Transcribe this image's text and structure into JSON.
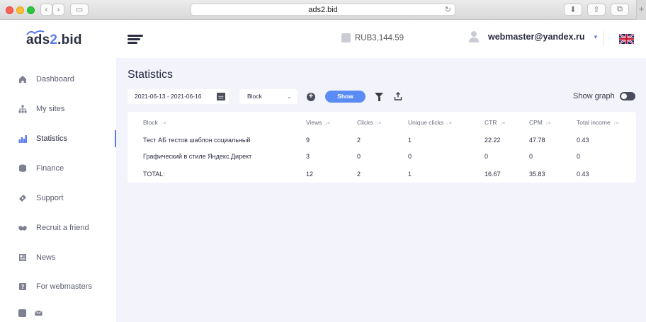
{
  "browser": {
    "url": "ads2.bid"
  },
  "header": {
    "logo_prefix": "ads",
    "logo_two": "2",
    "logo_suffix": ".bid",
    "balance": "RUB3,144.59",
    "user_email": "webmaster@yandex.ru",
    "language": "English (UK flag)"
  },
  "sidebar": {
    "items": [
      {
        "label": "Dashboard",
        "icon": "home-icon"
      },
      {
        "label": "My sites",
        "icon": "sitemap-icon"
      },
      {
        "label": "Statistics",
        "icon": "bar-chart-icon",
        "active": true
      },
      {
        "label": "Finance",
        "icon": "database-icon"
      },
      {
        "label": "Support",
        "icon": "ticket-icon"
      },
      {
        "label": "Recruit a friend",
        "icon": "handshake-icon"
      },
      {
        "label": "News",
        "icon": "newspaper-icon"
      },
      {
        "label": "For webmasters",
        "icon": "question-icon"
      }
    ],
    "social": [
      "facebook-icon",
      "mail-icon"
    ]
  },
  "main": {
    "title": "Statistics",
    "date_range": "2021-06-13 - 2021-06-16",
    "group_by": "Block",
    "show_label": "Show",
    "show_graph_label": "Show graph",
    "show_graph_on": false
  },
  "table": {
    "columns": [
      "Block",
      "Views",
      "Clicks",
      "Unique clicks",
      "CTR",
      "CPM",
      "Total income"
    ],
    "rows": [
      [
        "Тест АБ тестов шаблон социальный",
        "9",
        "2",
        "1",
        "22.22",
        "47.78",
        "0.43"
      ],
      [
        "Графический в стиле Яндекс.Директ",
        "3",
        "0",
        "0",
        "0",
        "0",
        "0"
      ]
    ],
    "total": [
      "TOTAL:",
      "12",
      "2",
      "1",
      "16.67",
      "35.83",
      "0.43"
    ]
  },
  "colors": {
    "accent": "#5b8cf5",
    "text": "#2b2d42",
    "background": "#f2f3fb"
  }
}
